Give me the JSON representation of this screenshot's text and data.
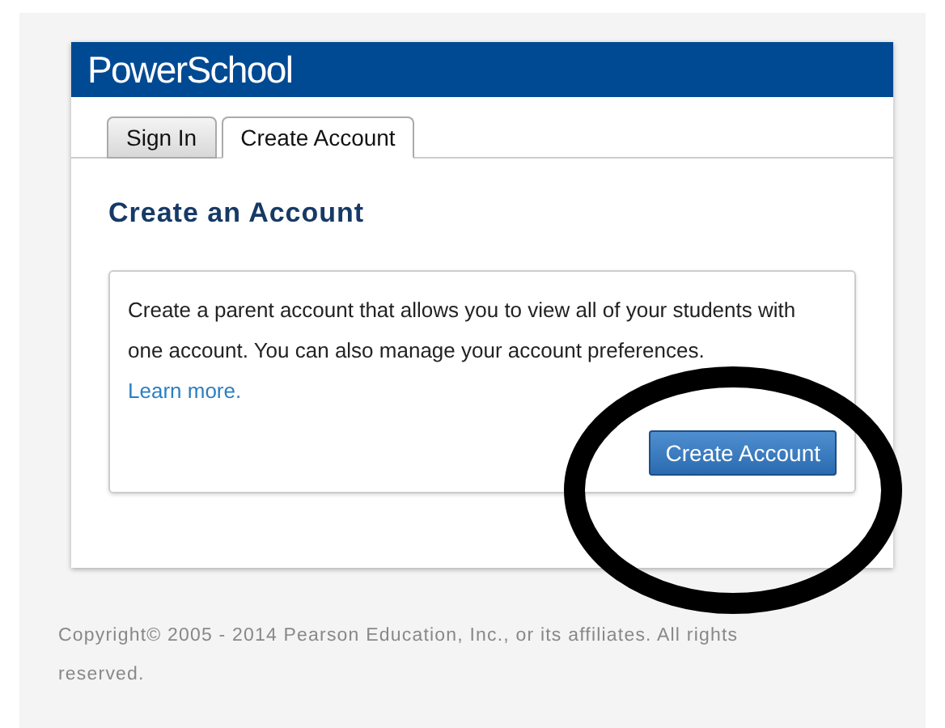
{
  "header": {
    "logo": "PowerSchool"
  },
  "tabs": [
    {
      "label": "Sign In",
      "selected": false
    },
    {
      "label": "Create Account",
      "selected": true
    }
  ],
  "heading": "Create an Account",
  "info": {
    "text": "Create a parent account that allows you to view all of your students with one account. You can also manage your account preferences.",
    "link": "Learn more."
  },
  "button": "Create Account",
  "annotation": {
    "kind": "circle"
  },
  "footer": "Copyright© 2005 - 2014 Pearson Education, Inc., or its affiliates. All rights reserved."
}
